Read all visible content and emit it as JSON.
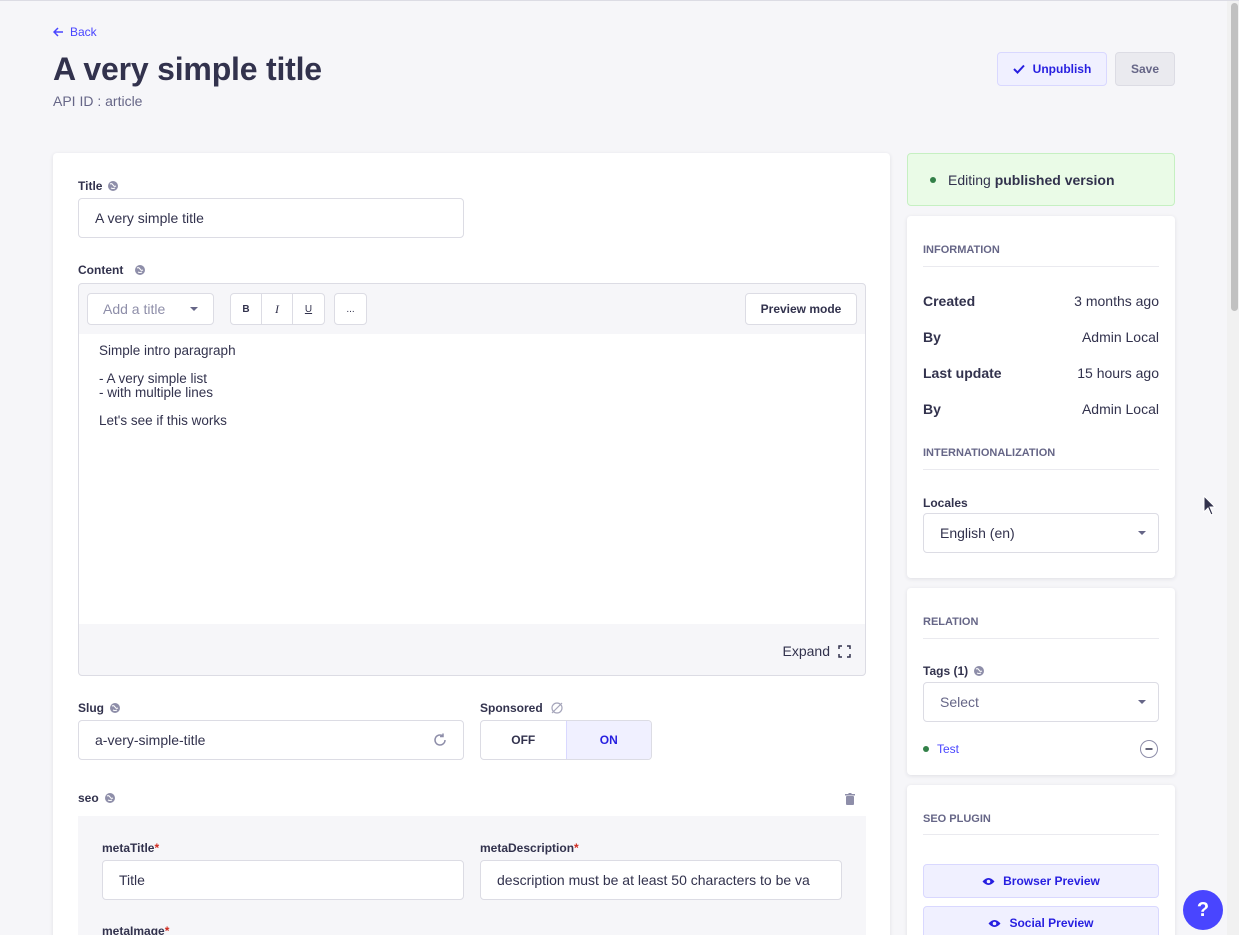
{
  "nav": {
    "back_label": "Back"
  },
  "header": {
    "title": "A very simple title",
    "api_id": "API ID : article",
    "unpublish_label": "Unpublish",
    "save_label": "Save"
  },
  "form": {
    "title_label": "Title",
    "title_value": "A very simple title",
    "content_label": "Content",
    "editor": {
      "heading_placeholder": "Add a title",
      "bold": "B",
      "italic": "I",
      "underline": "U",
      "more": "...",
      "preview_label": "Preview mode",
      "expand_label": "Expand",
      "lines": [
        "Simple intro paragraph",
        "- A very simple list",
        "- with multiple lines",
        "Let's see if this works"
      ]
    },
    "slug_label": "Slug",
    "slug_value": "a-very-simple-title",
    "sponsored_label": "Sponsored",
    "toggle_off": "OFF",
    "toggle_on": "ON",
    "toggle_selected": "ON",
    "seo_label": "seo",
    "meta_title_label": "metaTitle",
    "meta_title_value": "Title",
    "meta_description_label": "metaDescription",
    "meta_description_value": "description must be at least 50 characters to be va",
    "meta_image_label": "metaImage",
    "required_mark": "*"
  },
  "sidebar": {
    "status_prefix": "Editing ",
    "status_bold": "published version",
    "information_title": "Information",
    "info": [
      {
        "key": "Created",
        "value": "3 months ago"
      },
      {
        "key": "By",
        "value": "Admin Local"
      },
      {
        "key": "Last update",
        "value": "15 hours ago"
      },
      {
        "key": "By",
        "value": "Admin Local"
      }
    ],
    "i18n_title": "Internationalization",
    "locales_label": "Locales",
    "locale_value": "English (en)",
    "relation_title": "Relation",
    "tags_label": "Tags (1)",
    "tags_placeholder": "Select",
    "tag_item": "Test",
    "seo_plugin_title": "SEO Plugin",
    "browser_preview_label": "Browser Preview",
    "social_preview_label": "Social Preview"
  },
  "help_label": "?",
  "colors": {
    "primary": "#4945ff",
    "success": "#328048",
    "danger": "#d02b20"
  }
}
